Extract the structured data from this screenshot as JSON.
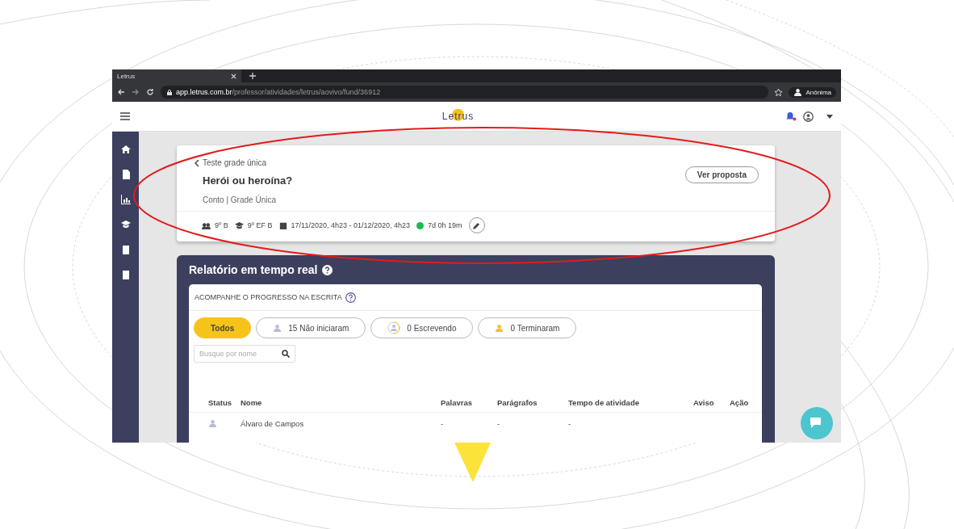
{
  "browser": {
    "tab_title": "Letrus",
    "url_host": "app.letrus.com.br",
    "url_path": "/professor/atividades/letrus/aovivo/fund/36912",
    "profile": "Anônima"
  },
  "header": {
    "logo": "Letrus"
  },
  "activity": {
    "back_link": "Teste grade única",
    "title": "Herói ou heroína?",
    "subtitle": "Conto | Grade Única",
    "button": "Ver proposta",
    "meta": [
      {
        "kind": "class",
        "text": "9º B"
      },
      {
        "kind": "grade",
        "text": "9º EF B"
      },
      {
        "kind": "date",
        "text": "17/11/2020, 4h23 - 01/12/2020, 4h23"
      },
      {
        "kind": "time",
        "text": "7d 0h 19m"
      }
    ]
  },
  "report": {
    "title": "Relatório em tempo real",
    "section": "ACOMPANHE O PROGRESSO NA ESCRITA",
    "filters": [
      {
        "kind": "all",
        "label": "Todos",
        "selected": true
      },
      {
        "kind": "not_started",
        "label": "15 Não iniciaram",
        "selected": false
      },
      {
        "kind": "writing",
        "label": "0 Escrevendo",
        "selected": false
      },
      {
        "kind": "finished",
        "label": "0 Terminaram",
        "selected": false
      }
    ],
    "search": {
      "placeholder": "Busque por nome"
    },
    "columns": [
      "Status",
      "Nome",
      "Palavras",
      "Parágrafos",
      "Tempo de atividade",
      "Aviso",
      "Ação"
    ],
    "rows": [
      {
        "name": "Álvaro de Campos",
        "words": "-",
        "paragraphs": "-",
        "time": "-"
      }
    ]
  }
}
